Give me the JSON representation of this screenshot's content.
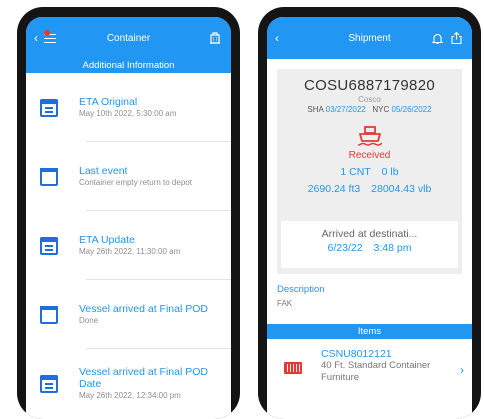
{
  "left": {
    "header": {
      "title": "Container"
    },
    "section_title": "Additional Information",
    "events": [
      {
        "icon": "calendar-icon",
        "title": "ETA Original",
        "sub": "May 10th 2022, 5:30:00 am"
      },
      {
        "icon": "container-icon",
        "title": "Last event",
        "sub": "Container empty return to depot"
      },
      {
        "icon": "calendar-icon",
        "title": "ETA Update",
        "sub": "May 26th 2022, 11:30:00 am"
      },
      {
        "icon": "container-icon",
        "title": "Vessel arrived at Final POD",
        "sub": "Done"
      },
      {
        "icon": "calendar-icon",
        "title": "Vessel arrived at Final POD Date",
        "sub": "May 26th 2022, 12:34:00 pm"
      }
    ]
  },
  "right": {
    "header": {
      "title": "Shipment"
    },
    "shipment_number": "COSU6887179820",
    "carrier": "Cosco",
    "origin": "SHA",
    "origin_date": "03/27/2022",
    "destination": "NYC",
    "destination_date": "05/26/2022",
    "status": "Received",
    "containers": "1 CNT",
    "weight": "0 lb",
    "volume": "2690.24 ft3",
    "volume_weight": "28004.43 vlb",
    "arrival_title": "Arrived at destinati...",
    "arrival_date": "6/23/22",
    "arrival_time": "3:48 pm",
    "description_label": "Description",
    "description_value": "FAK",
    "items_title": "Items",
    "item": {
      "number": "CSNU8012121",
      "type": "40 Ft. Standard Container",
      "commodity": "Furniture"
    }
  },
  "colors": {
    "accent": "#2196f3",
    "alert": "#e53935"
  }
}
